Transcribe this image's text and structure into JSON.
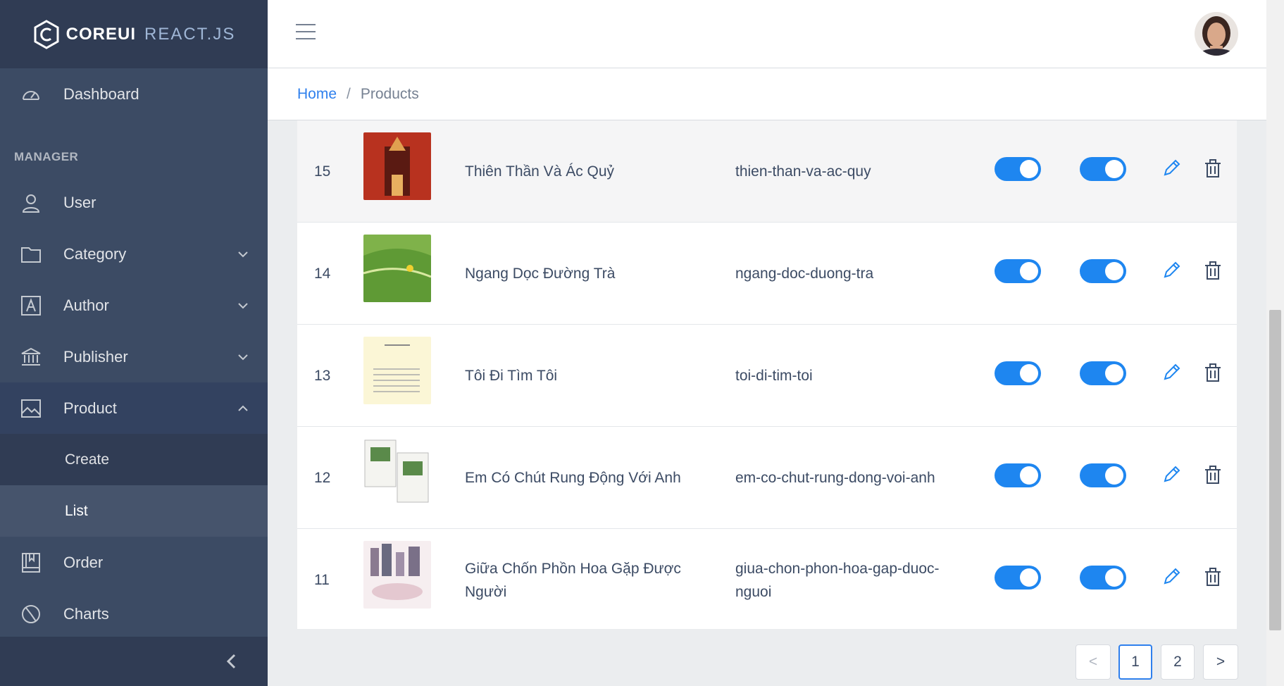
{
  "brand": {
    "name": "COREUI",
    "suffix": "REACT.JS"
  },
  "sidebar": {
    "section_title": "MANAGER",
    "items": [
      {
        "label": "Dashboard",
        "icon": "speedometer-icon"
      },
      {
        "label": "User",
        "icon": "user-icon"
      },
      {
        "label": "Category",
        "icon": "folder-icon"
      },
      {
        "label": "Author",
        "icon": "letter-a-icon"
      },
      {
        "label": "Publisher",
        "icon": "bank-icon"
      },
      {
        "label": "Product",
        "icon": "image-icon"
      },
      {
        "label": "Order",
        "icon": "book-icon"
      },
      {
        "label": "Charts",
        "icon": "chart-pie-icon"
      }
    ],
    "product_sub": [
      "Create",
      "List"
    ]
  },
  "breadcrumb": {
    "home": "Home",
    "current": "Products"
  },
  "products": [
    {
      "id": "15",
      "name": "Thiên Thần Và Ác Quỷ",
      "slug": "thien-than-va-ac-quy",
      "active": true,
      "featured": true
    },
    {
      "id": "14",
      "name": "Ngang Dọc Đường Trà",
      "slug": "ngang-doc-duong-tra",
      "active": true,
      "featured": true
    },
    {
      "id": "13",
      "name": "Tôi Đi Tìm Tôi",
      "slug": "toi-di-tim-toi",
      "active": true,
      "featured": true
    },
    {
      "id": "12",
      "name": "Em Có Chút Rung Động Với Anh",
      "slug": "em-co-chut-rung-dong-voi-anh",
      "active": true,
      "featured": true
    },
    {
      "id": "11",
      "name": "Giữa Chốn Phồn Hoa Gặp Được Người",
      "slug": "giua-chon-phon-hoa-gap-duoc-nguoi",
      "active": true,
      "featured": true
    }
  ],
  "pagination": {
    "prev": "<",
    "pages": [
      "1",
      "2"
    ],
    "next": ">",
    "current": "1"
  },
  "colors": {
    "sidebar": "#3c4b64",
    "accent": "#1e86f0",
    "link": "#2f80ed"
  }
}
